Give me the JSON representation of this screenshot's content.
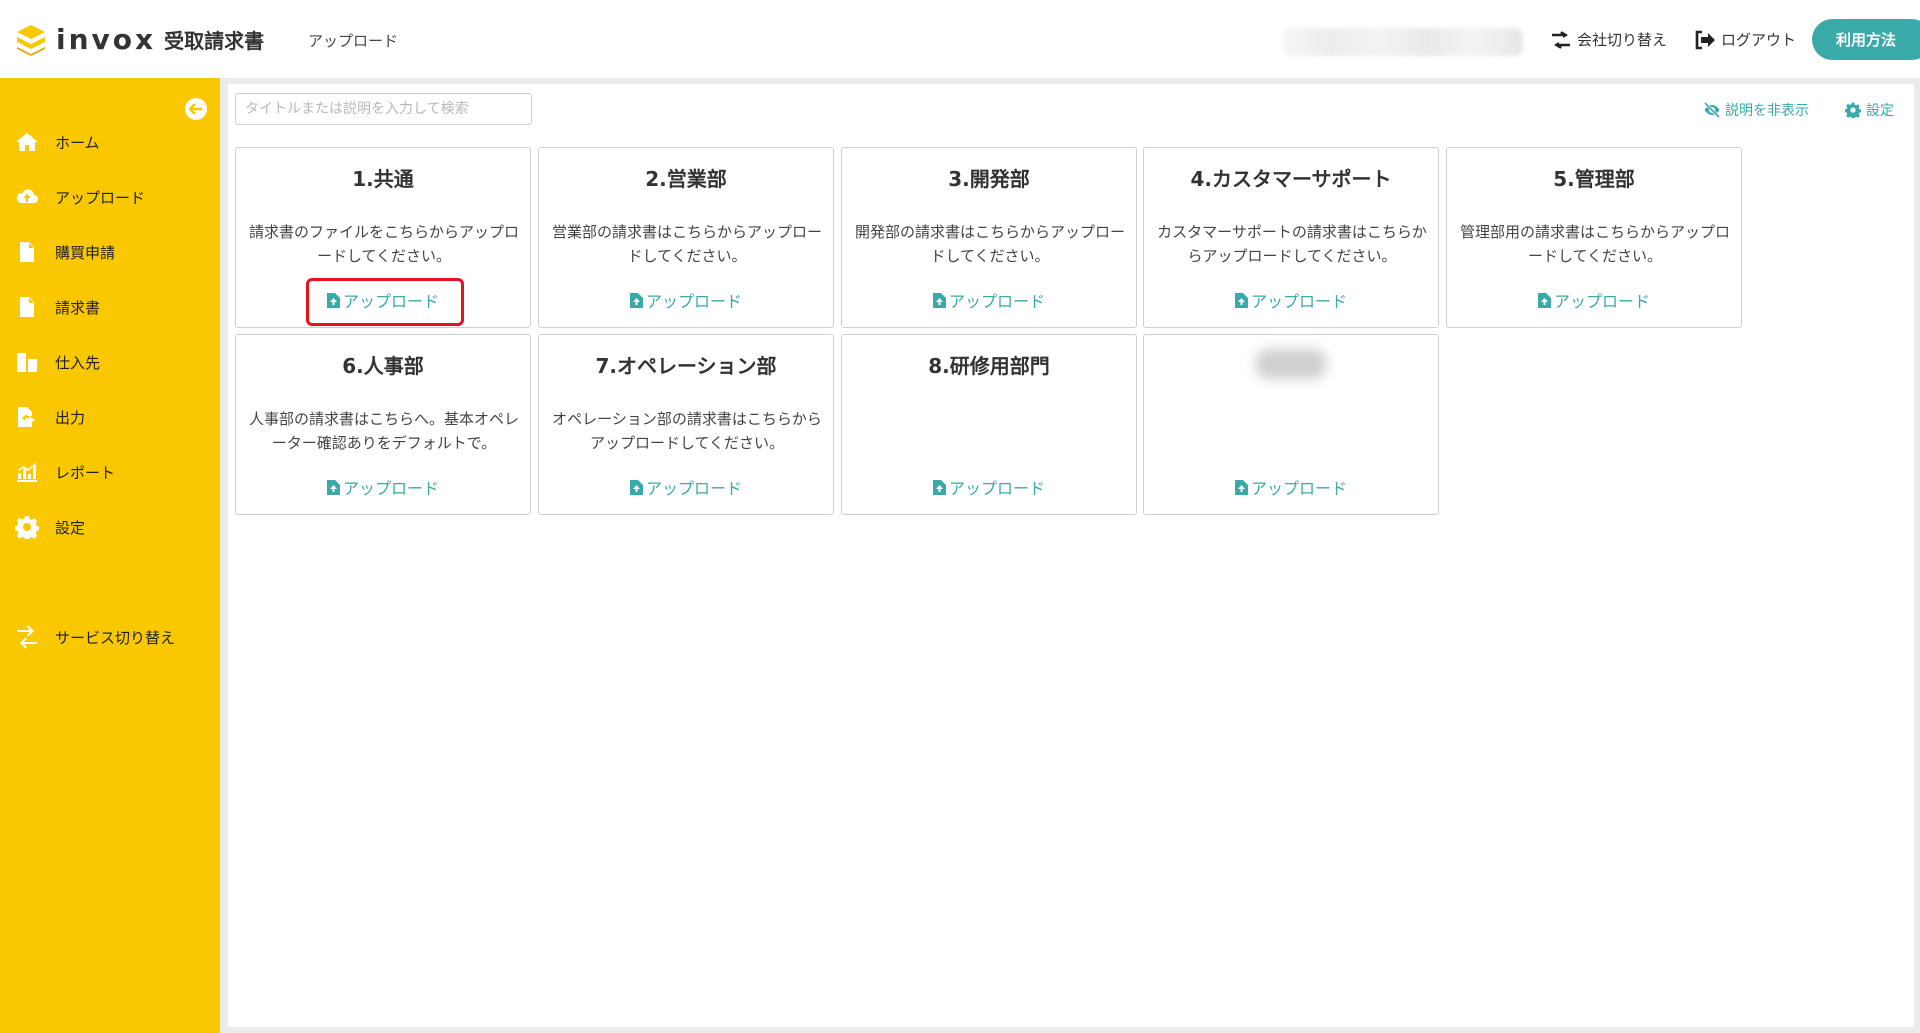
{
  "header": {
    "logo_word": "invox",
    "logo_sub": "受取請求書",
    "page_title": "アップロード",
    "switch_company": "会社切り替え",
    "logout": "ログアウト",
    "usage": "利用方法"
  },
  "sidebar": {
    "items": [
      {
        "label": "ホーム",
        "icon": "home-icon"
      },
      {
        "label": "アップロード",
        "icon": "cloud-upload-icon"
      },
      {
        "label": "購買申請",
        "icon": "document-icon"
      },
      {
        "label": "請求書",
        "icon": "document-icon"
      },
      {
        "label": "仕入先",
        "icon": "building-icon"
      },
      {
        "label": "出力",
        "icon": "export-icon"
      },
      {
        "label": "レポート",
        "icon": "chart-icon"
      },
      {
        "label": "設定",
        "icon": "gear-icon"
      }
    ],
    "service_switch": "サービス切り替え"
  },
  "toolbar": {
    "search_placeholder": "タイトルまたは説明を入力して検索",
    "hide_description": "説明を非表示",
    "settings": "設定"
  },
  "cards": [
    {
      "title": "1.共通",
      "description": "請求書のファイルをこちらからアップロードしてください。",
      "upload": "アップロード"
    },
    {
      "title": "2.営業部",
      "description": "営業部の請求書はこちらからアップロードしてください。",
      "upload": "アップロード"
    },
    {
      "title": "3.開発部",
      "description": "開発部の請求書はこちらからアップロードしてください。",
      "upload": "アップロード"
    },
    {
      "title": "4.カスタマーサポート",
      "description": "カスタマーサポートの請求書はこちらからアップロードしてください。",
      "upload": "アップロード"
    },
    {
      "title": "5.管理部",
      "description": "管理部用の請求書はこちらからアップロードしてください。",
      "upload": "アップロード"
    },
    {
      "title": "6.人事部",
      "description": "人事部の請求書はこちらへ。基本オペレーター確認ありをデフォルトで。",
      "upload": "アップロード"
    },
    {
      "title": "7.オペレーション部",
      "description": "オペレーション部の請求書はこちらからアップロードしてください。",
      "upload": "アップロード"
    },
    {
      "title": "8.研修用部門",
      "description": "",
      "upload": "アップロード"
    },
    {
      "title": "",
      "description": "",
      "upload": "アップロード"
    }
  ],
  "colors": {
    "sidebar": "#fac800",
    "accent": "#3aa9a9",
    "highlight": "#e3151b"
  }
}
